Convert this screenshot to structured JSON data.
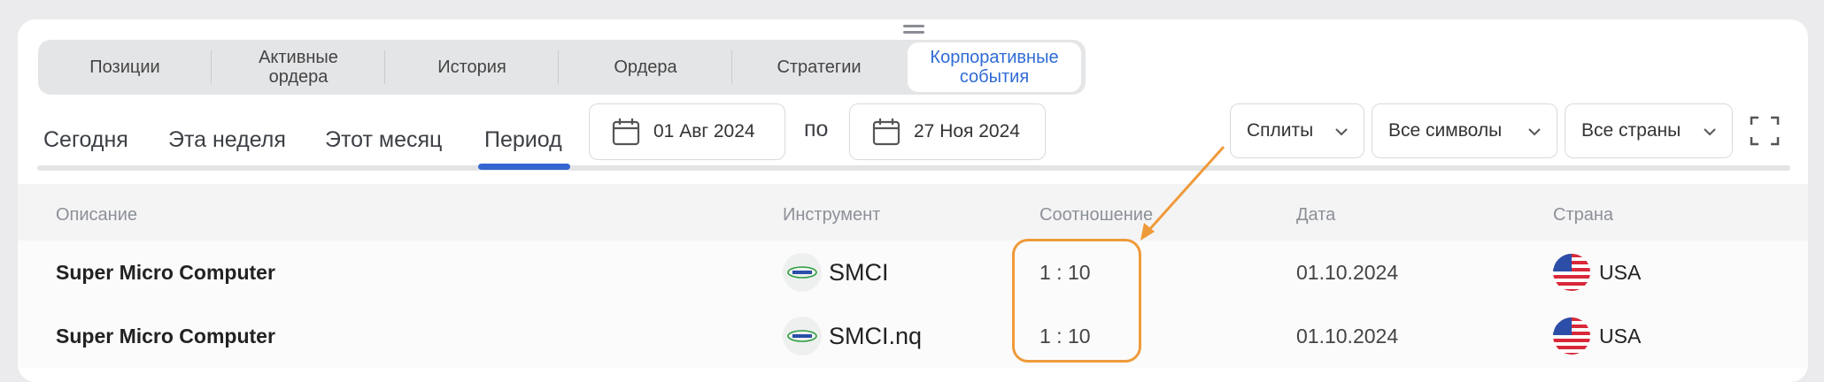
{
  "tabs": [
    {
      "label": "Позиции",
      "active": false
    },
    {
      "label": "Активные ордера",
      "active": false
    },
    {
      "label": "История",
      "active": false
    },
    {
      "label": "Ордера",
      "active": false
    },
    {
      "label": "Стратегии",
      "active": false
    },
    {
      "label": "Корпоративные события",
      "active": true
    }
  ],
  "period": {
    "today": "Сегодня",
    "week": "Эта неделя",
    "month": "Этот месяц",
    "custom": "Период",
    "active": "Период"
  },
  "date_from": "01 Авг 2024",
  "date_sep": "по",
  "date_to": "27 Ноя 2024",
  "filters": {
    "type": "Сплиты",
    "symbols": "Все символы",
    "countries": "Все страны"
  },
  "table": {
    "columns": {
      "description": "Описание",
      "instrument": "Инструмент",
      "ratio": "Соотношение",
      "date": "Дата",
      "country": "Страна"
    },
    "rows": [
      {
        "description": "Super Micro Computer",
        "instrument": "SMCI",
        "ratio": "1 : 10",
        "date": "01.10.2024",
        "country": "USA"
      },
      {
        "description": "Super Micro Computer",
        "instrument": "SMCI.nq",
        "ratio": "1 : 10",
        "date": "01.10.2024",
        "country": "USA"
      }
    ]
  },
  "colors": {
    "accent": "#3565d0",
    "annotation": "#ef9a3a"
  }
}
